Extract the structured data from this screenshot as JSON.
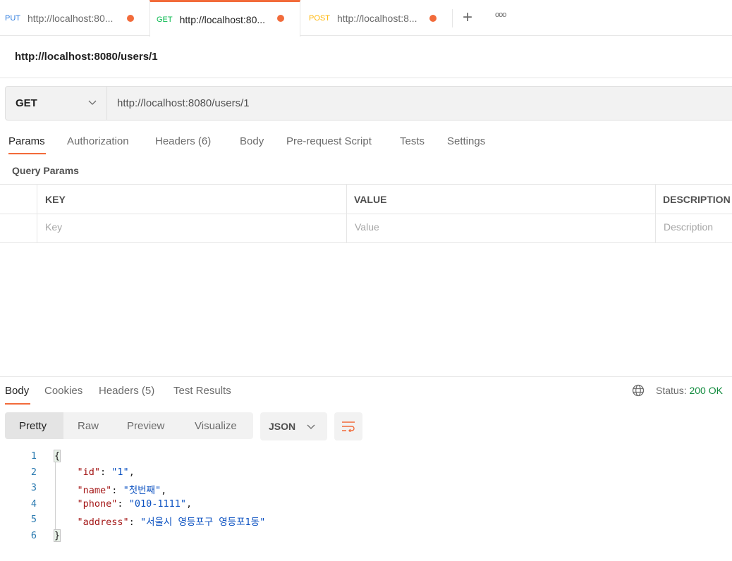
{
  "tabs": [
    {
      "method": "PUT",
      "method_color": "#2a7ade",
      "label": "http://localhost:80..."
    },
    {
      "method": "GET",
      "method_color": "#0cbb52",
      "label": "http://localhost:80...",
      "active": true
    },
    {
      "method": "POST",
      "method_color": "#ffb400",
      "label": "http://localhost:8..."
    }
  ],
  "tabbar": {
    "add_icon": "plus-icon",
    "more_icon": "more-horizontal-icon"
  },
  "request": {
    "title": "http://localhost:8080/users/1",
    "method": "GET",
    "url": "http://localhost:8080/users/1"
  },
  "request_tabs": {
    "params": "Params",
    "authorization": "Authorization",
    "headers": "Headers",
    "headers_count": "(6)",
    "body": "Body",
    "prerequest": "Pre-request Script",
    "tests": "Tests",
    "settings": "Settings"
  },
  "query_params": {
    "title": "Query Params",
    "columns": [
      "KEY",
      "VALUE",
      "DESCRIPTION"
    ],
    "placeholders": [
      "Key",
      "Value",
      "Description"
    ]
  },
  "response": {
    "tabs": {
      "body": "Body",
      "cookies": "Cookies",
      "headers": "Headers",
      "headers_count": "(5)",
      "tests": "Test Results"
    },
    "status_label": "Status:",
    "status_value": "200 OK",
    "status_color": "#0f8a3c",
    "views": [
      "Pretty",
      "Raw",
      "Preview",
      "Visualize"
    ],
    "format": "JSON",
    "lines": [
      {
        "n": "1",
        "parts": [
          {
            "t": "{",
            "c": "brace"
          }
        ]
      },
      {
        "n": "2",
        "parts": [
          {
            "t": "    "
          },
          {
            "t": "\"id\"",
            "c": "k"
          },
          {
            "t": ": "
          },
          {
            "t": "\"1\"",
            "c": "s"
          },
          {
            "t": ","
          }
        ]
      },
      {
        "n": "3",
        "parts": [
          {
            "t": "    "
          },
          {
            "t": "\"name\"",
            "c": "k"
          },
          {
            "t": ": "
          },
          {
            "t": "\"첫번째\"",
            "c": "s"
          },
          {
            "t": ","
          }
        ]
      },
      {
        "n": "4",
        "parts": [
          {
            "t": "    "
          },
          {
            "t": "\"phone\"",
            "c": "k"
          },
          {
            "t": ": "
          },
          {
            "t": "\"010-1111\"",
            "c": "s"
          },
          {
            "t": ","
          }
        ]
      },
      {
        "n": "5",
        "parts": [
          {
            "t": "    "
          },
          {
            "t": "\"address\"",
            "c": "k"
          },
          {
            "t": ": "
          },
          {
            "t": "\"서울시 영등포구 영등포1동\"",
            "c": "s"
          }
        ]
      },
      {
        "n": "6",
        "parts": [
          {
            "t": "}",
            "c": "brace"
          }
        ]
      }
    ]
  }
}
